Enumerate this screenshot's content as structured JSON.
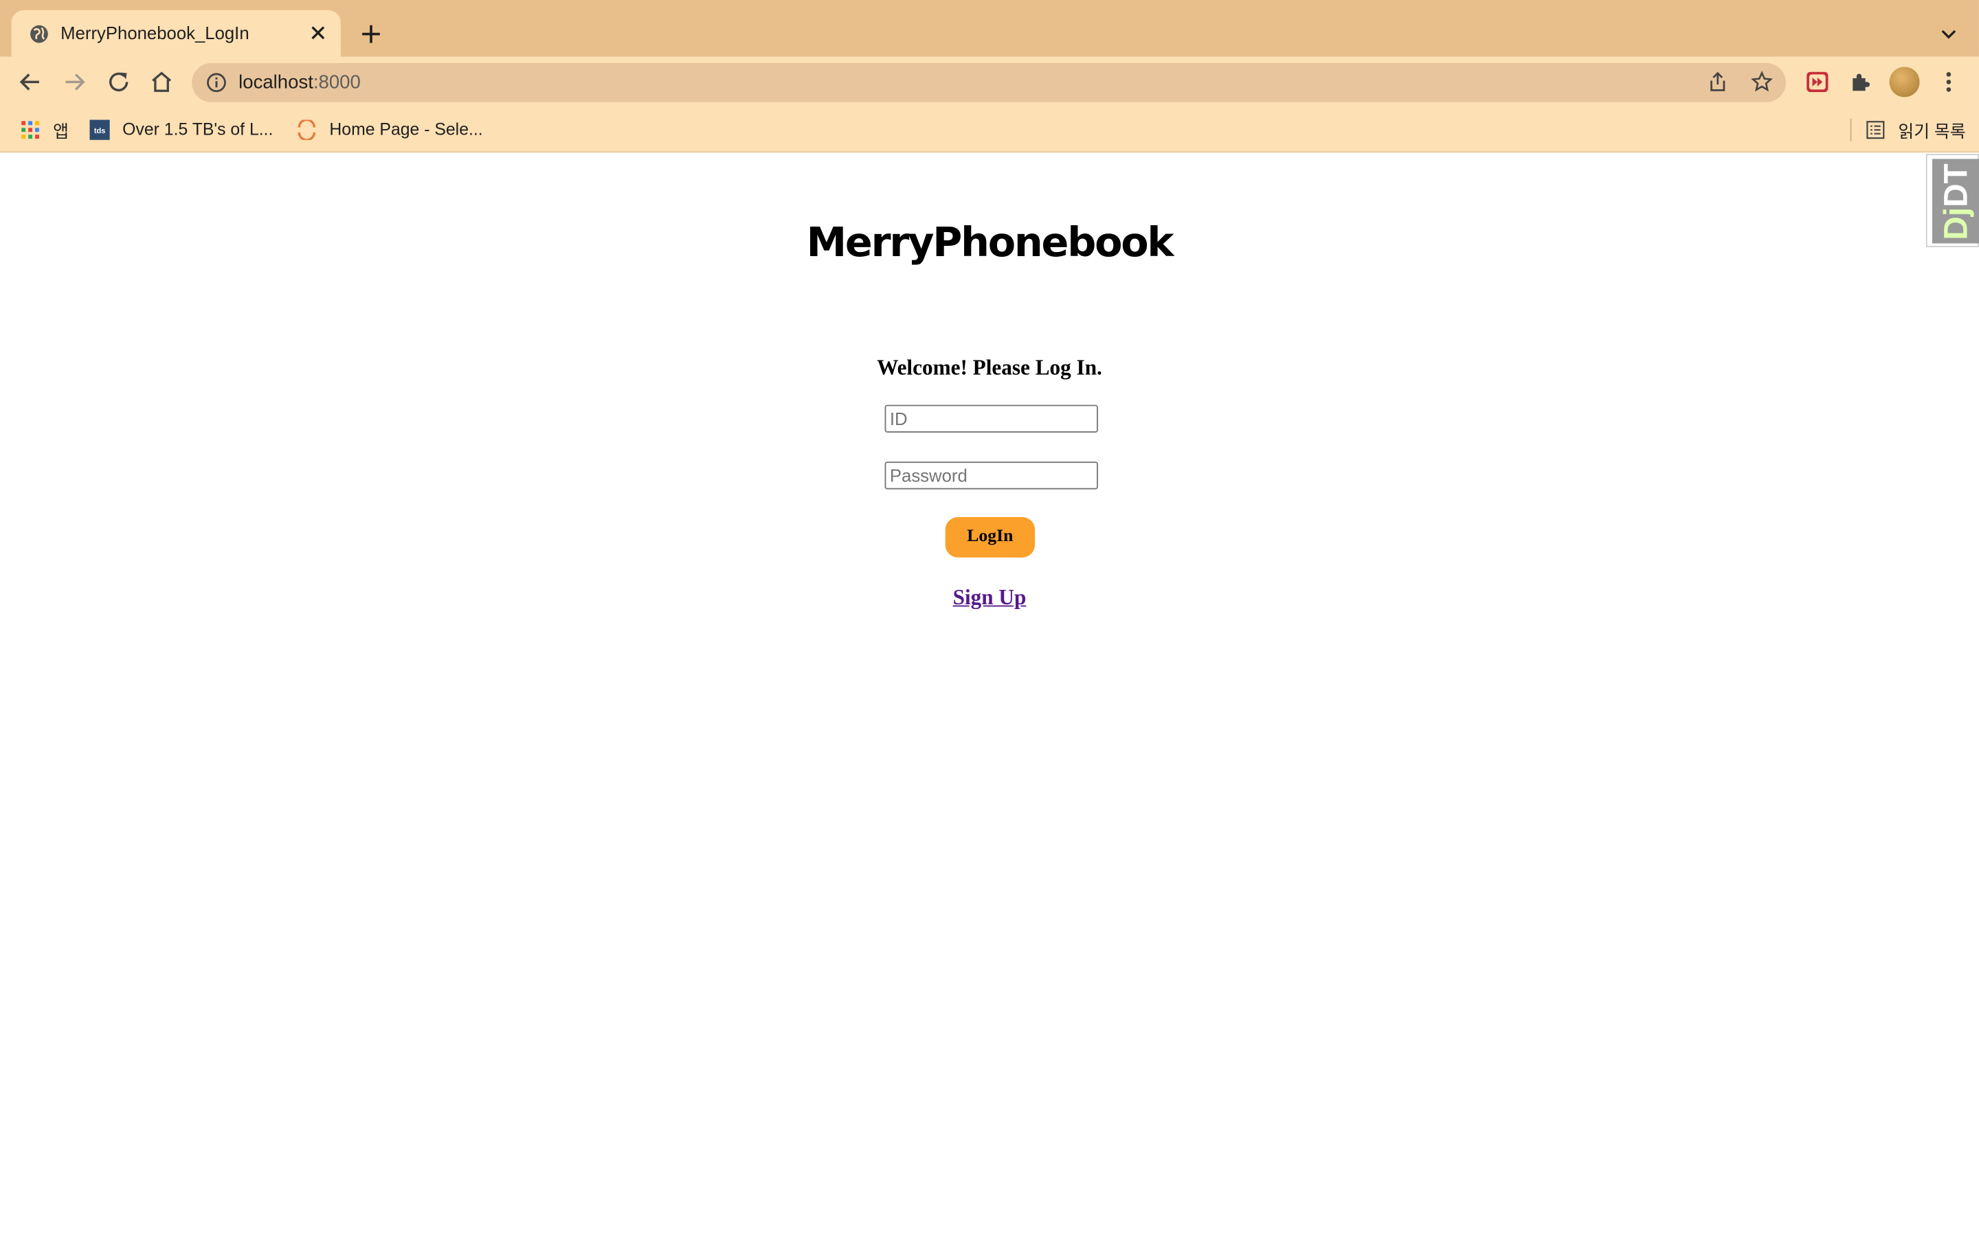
{
  "browser": {
    "tab": {
      "title": "MerryPhonebook_LogIn"
    },
    "address": {
      "host": "localhost",
      "port": ":8000"
    },
    "bookmarks": [
      {
        "label": "앱",
        "icon": "apps-grid-icon"
      },
      {
        "label": "Over 1.5 TB's of L...",
        "icon": "tds-favicon"
      },
      {
        "label": "Home Page - Sele...",
        "icon": "selenium-favicon"
      }
    ],
    "reading_list": "읽기 목록"
  },
  "page": {
    "brand": "MerryPhonebook",
    "welcome": "Welcome! Please Log In.",
    "id_placeholder": "ID",
    "password_placeholder": "Password",
    "login_label": "LogIn",
    "signup_label": "Sign Up"
  },
  "debug_toolbar": {
    "label_dj": "Dj",
    "label_dt": "DT"
  },
  "colors": {
    "tabstrip": "#e8bf8b",
    "toolbar": "#fde0b4",
    "login_button": "#fba02b",
    "link": "#551a8b"
  }
}
